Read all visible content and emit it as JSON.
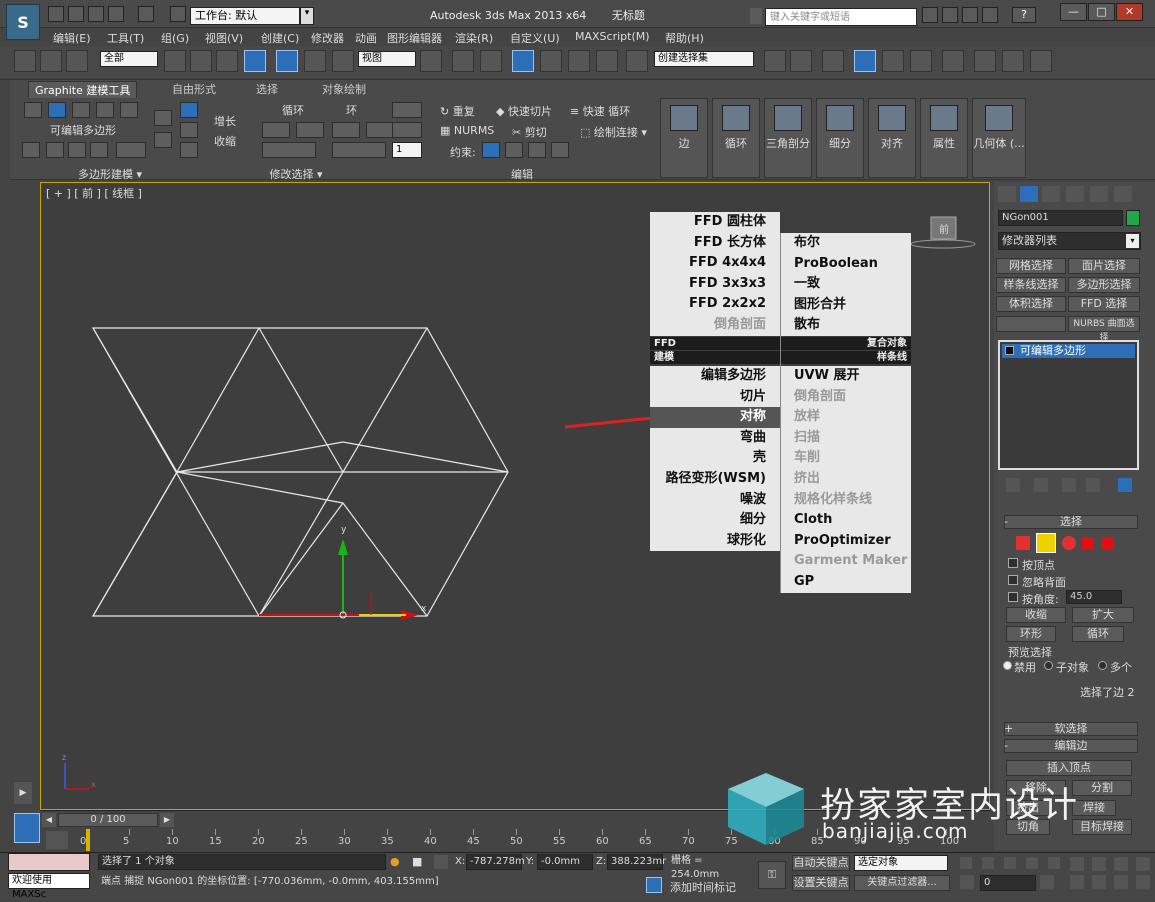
{
  "app": {
    "title": "Autodesk 3ds Max  2013 x64",
    "document": "无标题",
    "workspace": "工作台: 默认",
    "search_placeholder": "键入关键字或短语",
    "window_buttons": [
      "—",
      "□",
      "✕"
    ],
    "help_label": "?",
    "logo": "S"
  },
  "menubar": [
    "编辑(E)",
    "工具(T)",
    "组(G)",
    "视图(V)",
    "创建(C)",
    "修改器",
    "动画",
    "图形编辑器",
    "渲染(R)",
    "自定义(U)",
    "MAXScript(M)",
    "帮助(H)"
  ],
  "toolbar": {
    "selection_filter": "全部",
    "ref_coord": "视图",
    "named_selection": "创建选择集"
  },
  "ribbon": {
    "tabs": [
      "Graphite 建模工具",
      "自由形式",
      "选择",
      "对象绘制"
    ],
    "active_tab": 0,
    "group1_label": "可编辑多边形",
    "group1_footer": "多边形建模 ▾",
    "grow": "增长",
    "shrink": "收缩",
    "loop": "循环",
    "ring": "环",
    "group2_footer": "修改选择 ▾",
    "repeat": "重复",
    "quick_slice": "快速切片",
    "quick_loop": "快速 循环",
    "nurms": "NURMS",
    "cut": "剪切",
    "draw_connect": "绘制连接",
    "constraints": "约束:",
    "edit_footer": "编辑",
    "spinner_value": "1",
    "panels": [
      "边",
      "循环",
      "三角剖分",
      "细分",
      "对齐",
      "属性",
      "几何体 (..."
    ]
  },
  "viewport": {
    "label": "[ + ] [ 前 ] [ 线框 ]",
    "viewcube_label": "前",
    "axis_y": "y",
    "axis_x": "x",
    "triad_z": "z",
    "triad_x": "x"
  },
  "quad_menu": {
    "left_top": [
      {
        "label": "FFD 圆柱体",
        "disabled": false
      },
      {
        "label": "FFD 长方体",
        "disabled": false
      },
      {
        "label": "FFD 4x4x4",
        "disabled": false
      },
      {
        "label": "FFD 3x3x3",
        "disabled": false
      },
      {
        "label": "FFD 2x2x2",
        "disabled": false
      },
      {
        "label": "倒角剖面",
        "disabled": true
      }
    ],
    "right_top": [
      {
        "label": "布尔",
        "disabled": false
      },
      {
        "label": "ProBoolean",
        "disabled": false
      },
      {
        "label": "一致",
        "disabled": false
      },
      {
        "label": "图形合并",
        "disabled": false
      },
      {
        "label": "散布",
        "disabled": false
      }
    ],
    "bar1_left": "FFD",
    "bar1_right": "复合对象",
    "bar2_left": "建模",
    "bar2_right": "样条线",
    "left_bottom": [
      {
        "label": "编辑多边形",
        "disabled": false
      },
      {
        "label": "切片",
        "disabled": false
      },
      {
        "label": "对称",
        "disabled": false,
        "selected": true
      },
      {
        "label": "弯曲",
        "disabled": false
      },
      {
        "label": "壳",
        "disabled": false
      },
      {
        "label": "路径变形(WSM)",
        "disabled": false
      },
      {
        "label": "噪波",
        "disabled": false
      },
      {
        "label": "细分",
        "disabled": false
      },
      {
        "label": "球形化",
        "disabled": false
      }
    ],
    "right_bottom": [
      {
        "label": "UVW 展开",
        "disabled": false
      },
      {
        "label": "倒角剖面",
        "disabled": true
      },
      {
        "label": "放样",
        "disabled": true
      },
      {
        "label": "扫描",
        "disabled": true
      },
      {
        "label": "车削",
        "disabled": true
      },
      {
        "label": "挤出",
        "disabled": true
      },
      {
        "label": "规格化样条线",
        "disabled": true
      },
      {
        "label": "Cloth",
        "disabled": false
      },
      {
        "label": "ProOptimizer",
        "disabled": false
      },
      {
        "label": "Garment Maker",
        "disabled": true
      },
      {
        "label": "GP",
        "disabled": false
      }
    ]
  },
  "command_panel": {
    "object_name": "NGon001",
    "object_color": "#1fa84a",
    "modifier_list": "修改器列表",
    "quick_buttons": [
      "网格选择",
      "面片选择",
      "样条线选择",
      "多边形选择",
      "体积选择",
      "FFD 选择",
      "",
      "NURBS 曲面选择"
    ],
    "stack_item": "可编辑多边形",
    "selection_rollout": "选择",
    "by_vertex": "按顶点",
    "ignore_backfacing": "忽略背面",
    "by_angle": "按角度:",
    "angle_value": "45.0",
    "shrink": "收缩",
    "grow": "扩大",
    "ring": "环形",
    "loop": "循环",
    "preview_selection": "预览选择",
    "preview_options": [
      "禁用",
      "子对象",
      "多个"
    ],
    "selection_info": "选择了边 2",
    "soft_selection": "软选择",
    "edit_edges": "编辑边",
    "insert_vertex": "插入顶点",
    "remove": "移除",
    "split": "分割",
    "extrude": "挤出",
    "weld": "焊接",
    "chamfer": "切角",
    "target_weld": "目标焊接",
    "plus": "+",
    "minus": "-"
  },
  "timeline": {
    "frame_display": "0 / 100",
    "ticks": [
      "0",
      "5",
      "10",
      "15",
      "20",
      "25",
      "30",
      "35",
      "40",
      "45",
      "50",
      "55",
      "60",
      "65",
      "70",
      "75",
      "80",
      "85",
      "90",
      "95",
      "100"
    ]
  },
  "status": {
    "welcome": "欢迎使用 MAXSc",
    "selected": "选择了 1 个对象",
    "prompt": "端点 捕捉 NGon001 的坐标位置: [-770.036mm, -0.0mm, 403.155mm]",
    "x_label": "X:",
    "x_value": "-787.278m",
    "y_label": "Y:",
    "y_value": "-0.0mm",
    "z_label": "Z:",
    "z_value": "388.223mr",
    "grid": "栅格 = 254.0mm",
    "add_time_tag": "添加时间标记",
    "auto_key": "自动关键点",
    "set_key": "设置关键点",
    "key_mode": "选定对象",
    "key_filters": "关键点过滤器...",
    "frame": "0"
  },
  "watermark": {
    "title": "扮家家室内设计",
    "url": "banjiajia.com"
  },
  "colors": {
    "accent": "#2c6fb8",
    "viewport_border": "#c8a600",
    "arrow": "#e02020"
  }
}
